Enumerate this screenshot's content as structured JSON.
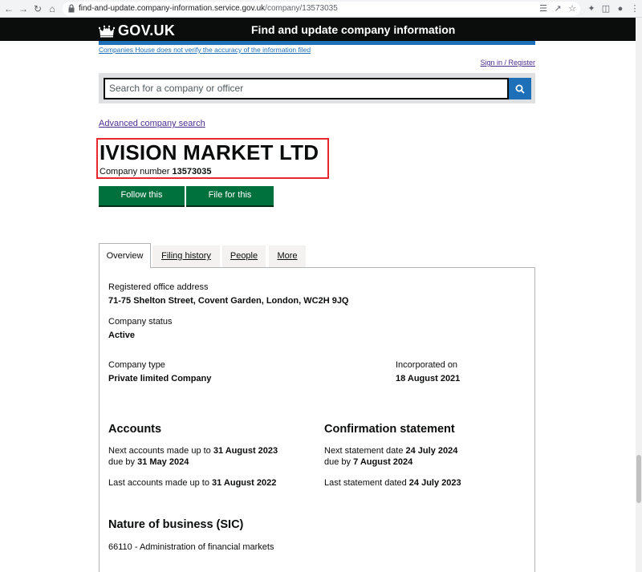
{
  "browser": {
    "url_domain": "find-and-update.company-information.service.gov.uk",
    "url_path": "/company/13573035"
  },
  "header": {
    "logo_text": "GOV.UK",
    "service_name": "Find and update company information"
  },
  "disclaimer": "Companies House does not verify the accuracy of the information filed",
  "sign_in": "Sign in / Register",
  "search": {
    "placeholder": "Search for a company or officer"
  },
  "advanced_search": "Advanced company search",
  "company": {
    "name": "IVISION MARKET LTD",
    "number_label": "Company number",
    "number": "13573035"
  },
  "actions": {
    "follow": "Follow this company",
    "file": "File for this company"
  },
  "tabs": [
    {
      "label": "Overview",
      "active": true
    },
    {
      "label": "Filing history",
      "active": false
    },
    {
      "label": "People",
      "active": false
    },
    {
      "label": "More",
      "active": false
    }
  ],
  "overview": {
    "registered_office_label": "Registered office address",
    "registered_office": "71-75 Shelton Street, Covent Garden, London, WC2H 9JQ",
    "status_label": "Company status",
    "status": "Active",
    "type_label": "Company type",
    "type": "Private limited Company",
    "incorporated_label": "Incorporated on",
    "incorporated": "18 August 2021"
  },
  "accounts": {
    "heading": "Accounts",
    "next_label": "Next accounts made up to",
    "next_date": "31 August 2023",
    "due_label": "due by",
    "due_date": "31 May 2024",
    "last_label": "Last accounts made up to",
    "last_date": "31 August 2022"
  },
  "confirmation": {
    "heading": "Confirmation statement",
    "next_label": "Next statement date",
    "next_date": "24 July 2024",
    "due_label": "due by",
    "due_date": "7 August 2024",
    "last_label": "Last statement dated",
    "last_date": "24 July 2023"
  },
  "sic": {
    "heading": "Nature of business (SIC)",
    "item": "66110 - Administration of financial markets"
  },
  "colors": {
    "header_bg": "#0b0c0c",
    "brand_blue": "#1d70b8",
    "button_green": "#00703c",
    "highlight_red": "#e8272f"
  }
}
